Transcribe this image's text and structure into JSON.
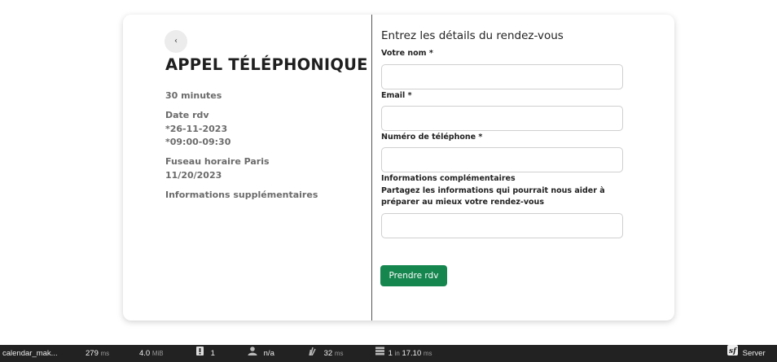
{
  "event": {
    "back_label": "‹",
    "title": "APPEL TÉLÉPHONIQUE",
    "duration": "30 minutes",
    "date_label": "Date rdv",
    "date_value": "*26-11-2023",
    "time_value": "*09:00-09:30",
    "timezone_label": "Fuseau horaire Paris",
    "timezone_date": "11/20/2023",
    "extra_info_label": "Informations supplémentaires"
  },
  "form": {
    "title": "Entrez les détails du rendez-vous",
    "name_label": "Votre nom *",
    "name_value": "",
    "email_label": "Email *",
    "email_value": "",
    "phone_label": "Numéro de téléphone *",
    "phone_value": "",
    "additional_label": "Informations complémentaires",
    "additional_help": "Partagez les informations qui pourrait nous aider à préparer au mieux votre rendez-vous",
    "additional_value": "",
    "submit_label": "Prendre rdv",
    "submit_color": "#16864f"
  },
  "debug_toolbar": {
    "route": "calendar_mak...",
    "time_value": "279",
    "time_unit": "ms",
    "memory_value": "4.0",
    "memory_unit": "MiB",
    "errors_count": "1",
    "user": "n/a",
    "twig_value": "32",
    "twig_unit": "ms",
    "db_queries": "1",
    "db_in": "in",
    "db_time": "17.10",
    "db_unit": "ms",
    "server_label": "Server",
    "icons": [
      "alert-icon",
      "user-icon",
      "twig-icon",
      "database-icon",
      "symfony-logo-icon"
    ]
  }
}
